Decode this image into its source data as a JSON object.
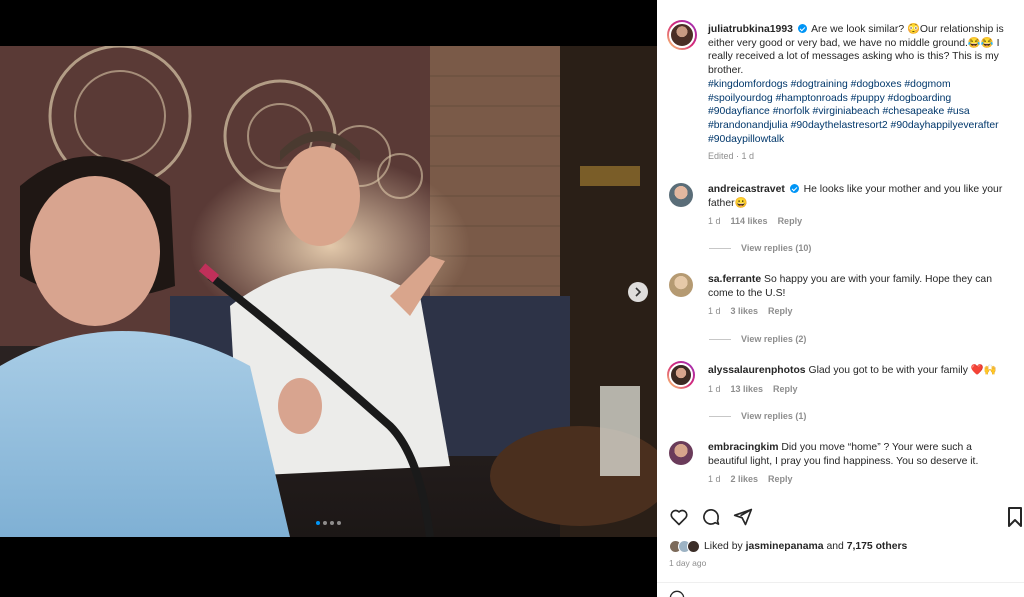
{
  "post": {
    "author": "juliatrubkina1993",
    "caption_text": "Are we look similar? 😳Our relationship is either very good or very bad, we have no middle ground.😂😂 I really received a lot of messages asking who is this? This is my brother.",
    "hashtags": "#kingdomfordogs #dogtraining #dogboxes #dogmom #spoilyourdog #hamptonroads #puppy #dogboarding #90dayfiance #norfolk #virginiabeach #chesapeake #usa #brandonandjulia #90daythelastresort2 #90dayhappilyeverafter #90daypillowtalk",
    "edited": "Edited · 1 d",
    "carousel_dots": 4,
    "carousel_active": 1
  },
  "comments": [
    {
      "user": "andreicastravet",
      "verified": true,
      "text": "He looks like your mother and you like your father😀",
      "age": "1 d",
      "likes": "114 likes",
      "reply": "Reply",
      "view_replies": "View replies (10)"
    },
    {
      "user": "sa.ferrante",
      "verified": false,
      "text": "So happy you are with your family. Hope they can come to the U.S!",
      "age": "1 d",
      "likes": "3 likes",
      "reply": "Reply",
      "view_replies": "View replies (2)"
    },
    {
      "user": "alyssalaurenphotos",
      "verified": false,
      "text": "Glad you got to be with your family ❤️🙌",
      "age": "1 d",
      "likes": "13 likes",
      "reply": "Reply",
      "view_replies": "View replies (1)"
    },
    {
      "user": "embracingkim",
      "verified": false,
      "text": "Did you move “home” ? Your were such a beautiful light, I pray you find happiness. You so deserve it.",
      "age": "1 d",
      "likes": "2 likes",
      "reply": "Reply"
    }
  ],
  "likes": {
    "prefix": "Liked by",
    "user": "jasminepanama",
    "and": "and",
    "others": "7,175 others"
  },
  "posted": "1 day ago",
  "colors": {
    "accent": "#0095f6",
    "hashtag": "#00376b",
    "muted": "#8e8e8e",
    "text": "#262626"
  },
  "icons": [
    "heart-icon",
    "comment-icon",
    "share-icon",
    "bookmark-icon",
    "verified-icon",
    "next-arrow-icon"
  ]
}
